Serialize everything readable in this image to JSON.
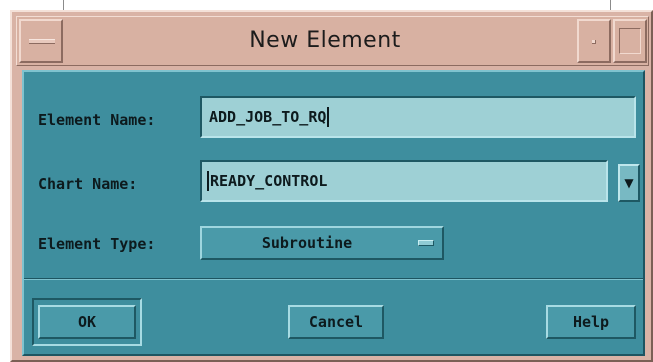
{
  "window": {
    "title": "New Element"
  },
  "form": {
    "element_name": {
      "label": "Element Name:",
      "value": "ADD_JOB_TO_RQ"
    },
    "chart_name": {
      "label": "Chart Name:",
      "value": "READY_CONTROL"
    },
    "element_type": {
      "label": "Element Type:",
      "value": "Subroutine"
    }
  },
  "buttons": {
    "ok": "OK",
    "cancel": "Cancel",
    "help": "Help"
  },
  "icons": {
    "window_menu": "window-menu-icon",
    "minimize": "minimize-icon",
    "maximize": "maximize-icon",
    "dropdown_arrow": "down-arrow-icon"
  },
  "colors": {
    "frame": "#d9b3a6",
    "client": "#3e8e9e",
    "field": "#9ed0d5",
    "button": "#4a9aa9"
  }
}
